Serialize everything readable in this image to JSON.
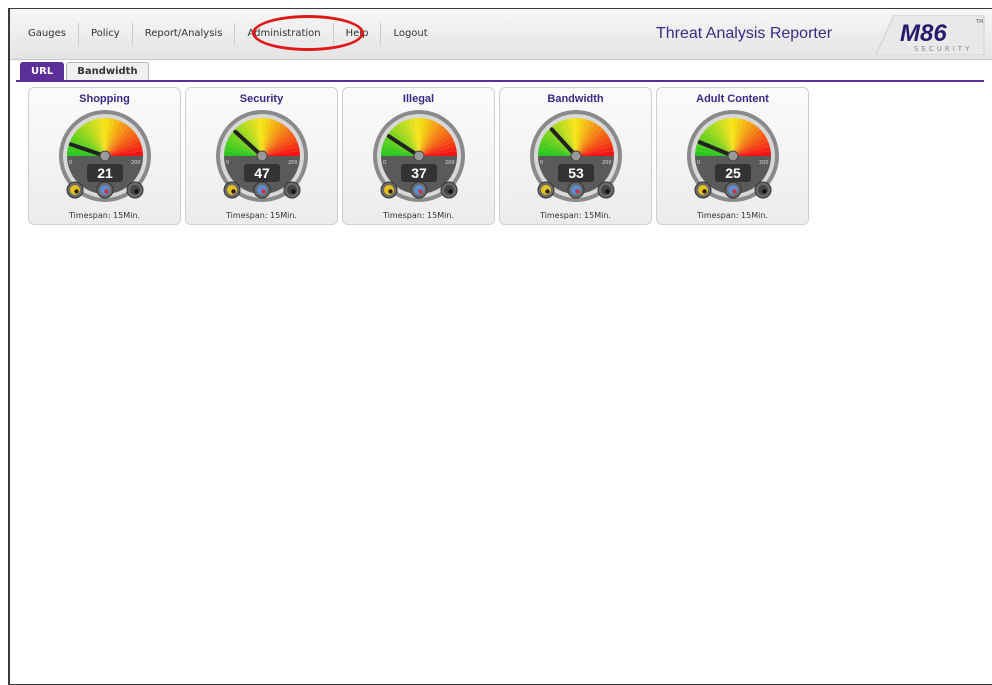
{
  "menu": [
    "Gauges",
    "Policy",
    "Report/Analysis",
    "Administration",
    "Help",
    "Logout"
  ],
  "app": {
    "title": "Threat Analysis Reporter",
    "logo_main": "M86",
    "logo_sub": "SECURITY",
    "logo_tm": "TM"
  },
  "tabs": [
    {
      "label": "URL",
      "active": true
    },
    {
      "label": "Bandwidth",
      "active": false
    }
  ],
  "gauges": [
    {
      "title": "Shopping",
      "value": "21",
      "min": "0",
      "max": "200",
      "timespan": "Timespan: 15Min."
    },
    {
      "title": "Security",
      "value": "47",
      "min": "0",
      "max": "200",
      "timespan": "Timespan: 15Min."
    },
    {
      "title": "Illegal",
      "value": "37",
      "min": "0",
      "max": "200",
      "timespan": "Timespan: 15Min."
    },
    {
      "title": "Bandwidth",
      "value": "53",
      "min": "0",
      "max": "200",
      "timespan": "Timespan: 15Min."
    },
    {
      "title": "Adult Content",
      "value": "25",
      "min": "0",
      "max": "200",
      "timespan": "Timespan: 15Min."
    }
  ],
  "colors": {
    "accent": "#5c2f98",
    "title": "#3c2a86",
    "highlight": "#e01818"
  }
}
